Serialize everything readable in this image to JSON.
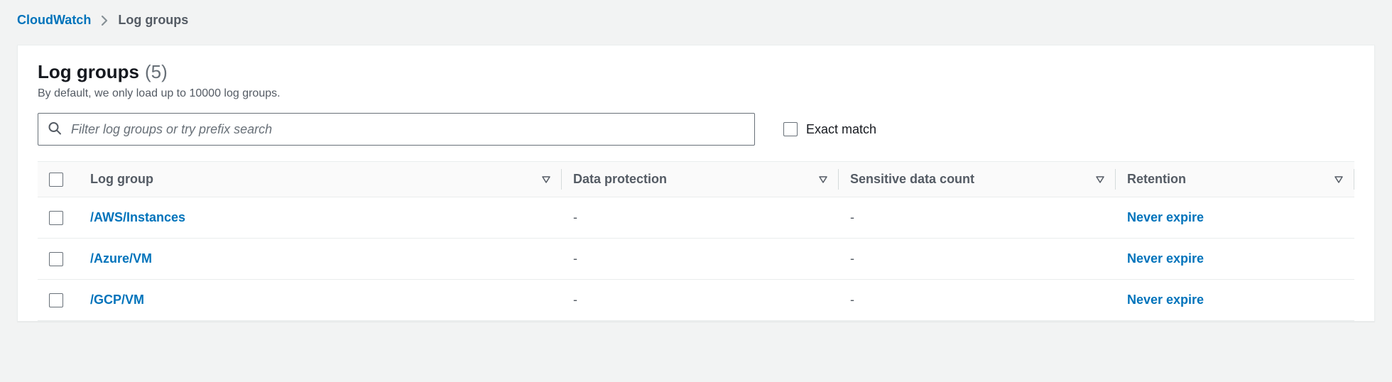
{
  "breadcrumb": {
    "root": "CloudWatch",
    "current": "Log groups"
  },
  "header": {
    "title": "Log groups",
    "count": "(5)",
    "subtitle": "By default, we only load up to 10000 log groups."
  },
  "filter": {
    "placeholder": "Filter log groups or try prefix search",
    "exact_match_label": "Exact match"
  },
  "table": {
    "columns": {
      "log_group": "Log group",
      "data_protection": "Data protection",
      "sensitive_count": "Sensitive data count",
      "retention": "Retention"
    },
    "rows": [
      {
        "log_group": "/AWS/Instances",
        "data_protection": "-",
        "sensitive_count": "-",
        "retention": "Never expire"
      },
      {
        "log_group": "/Azure/VM",
        "data_protection": "-",
        "sensitive_count": "-",
        "retention": "Never expire"
      },
      {
        "log_group": "/GCP/VM",
        "data_protection": "-",
        "sensitive_count": "-",
        "retention": "Never expire"
      }
    ]
  }
}
